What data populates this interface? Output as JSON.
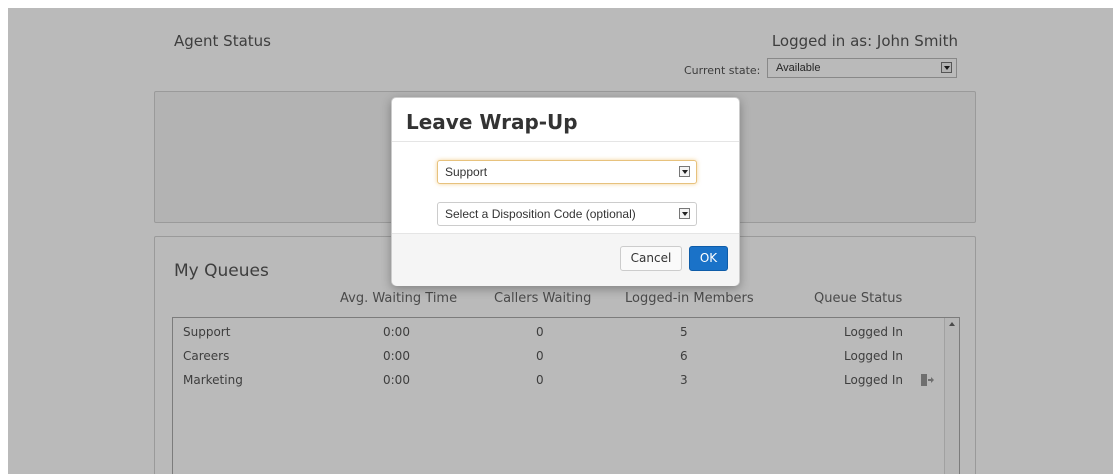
{
  "header": {
    "title": "Agent Status",
    "logged_in": "Logged in as: John Smith",
    "current_state_label": "Current state:",
    "current_state_value": "Available"
  },
  "queues": {
    "title": "My Queues",
    "columns": [
      "Avg. Waiting Time",
      "Callers Waiting",
      "Logged-in Members",
      "Queue Status"
    ],
    "rows": [
      {
        "name": "Support",
        "avg_wait": "0:00",
        "callers": "0",
        "members": "5",
        "status": "Logged In"
      },
      {
        "name": "Careers",
        "avg_wait": "0:00",
        "callers": "0",
        "members": "6",
        "status": "Logged In"
      },
      {
        "name": "Marketing",
        "avg_wait": "0:00",
        "callers": "0",
        "members": "3",
        "status": "Logged In"
      }
    ]
  },
  "modal": {
    "title": "Leave Wrap-Up",
    "queue_select": "Support",
    "disposition_select": "Select a Disposition Code (optional)",
    "cancel_label": "Cancel",
    "ok_label": "OK"
  },
  "colors": {
    "primary": "#1a72c8",
    "overlay": "rgba(0,0,0,0.27)",
    "focus": "#e7c27d"
  },
  "icons": {
    "dropdown": "chevron-down-icon",
    "exit": "logout-icon",
    "scroll": "scroll-up-icon"
  }
}
